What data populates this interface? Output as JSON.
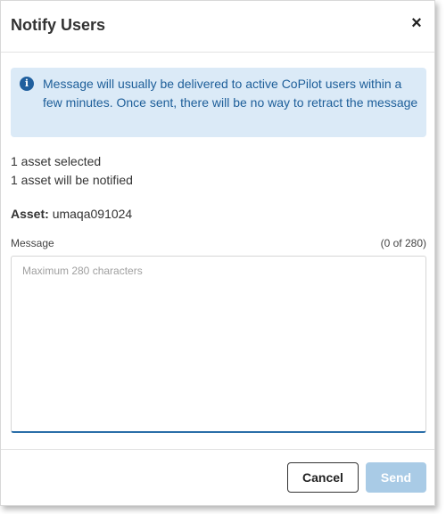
{
  "dialog": {
    "title": "Notify Users",
    "close_glyph": "×"
  },
  "info": {
    "icon": "info-icon",
    "text": "Message will usually be delivered to active CoPilot users within a few minutes. Once sent, there will be no way to retract the message"
  },
  "selection": {
    "selected_text": "1 asset selected",
    "notified_text": "1 asset will be notified"
  },
  "asset": {
    "label": "Asset:",
    "value": "umaqa091024"
  },
  "message": {
    "label": "Message",
    "counter": "(0 of 280)",
    "value": "",
    "placeholder": "Maximum 280 characters"
  },
  "buttons": {
    "cancel_label": "Cancel",
    "send_label": "Send"
  },
  "colors": {
    "info_background": "#dbeaf7",
    "info_text": "#1d5e99",
    "send_disabled": "#a9cbe6",
    "focus_underline": "#2a6ea8"
  }
}
